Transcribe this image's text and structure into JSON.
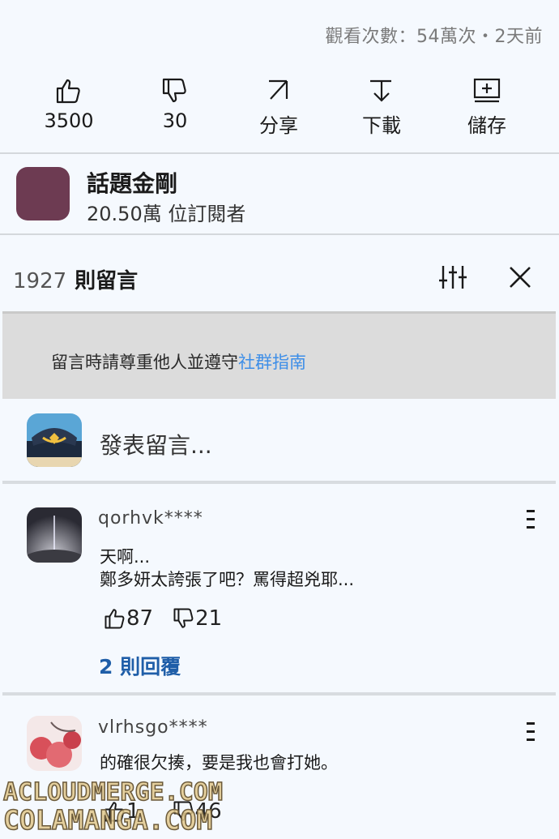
{
  "video": {
    "views_line": "觀看次數：54萬次・2天前"
  },
  "actions": [
    {
      "id": "like",
      "label": "3500"
    },
    {
      "id": "dislike",
      "label": "30"
    },
    {
      "id": "share",
      "label": "分享"
    },
    {
      "id": "download",
      "label": "下載"
    },
    {
      "id": "save",
      "label": "儲存"
    }
  ],
  "channel": {
    "name": "話題金剛",
    "subscribers": "20.50萬 位訂閱者",
    "avatar_color": "#6d3b52"
  },
  "comments_header": {
    "count": "1927",
    "word": "則留言"
  },
  "notice": {
    "text": "留言時請尊重他人並遵守",
    "link": "社群指南",
    "link_color": "#3d8ee8"
  },
  "composer": {
    "placeholder": "發表留言..."
  },
  "comments": [
    {
      "author": "qorhvk****",
      "line1": "天啊...",
      "line2": "鄭多妍太誇張了吧？罵得超兇耶...",
      "likes": "87",
      "dislikes": "21",
      "replies": "2 則回覆"
    },
    {
      "author": "vlrhsgo****",
      "line1": "的確很欠揍，要是我也會打她。",
      "likes": "1",
      "dislikes": "46"
    }
  ],
  "watermark": {
    "line1": "ACLOUDMERGE.COM",
    "line2": "COLAMANGA.COM"
  },
  "icons": [
    "thumbs-up-icon",
    "thumbs-down-icon",
    "share-icon",
    "download-icon",
    "save-icon",
    "filter-icon",
    "close-icon",
    "more-icon"
  ]
}
